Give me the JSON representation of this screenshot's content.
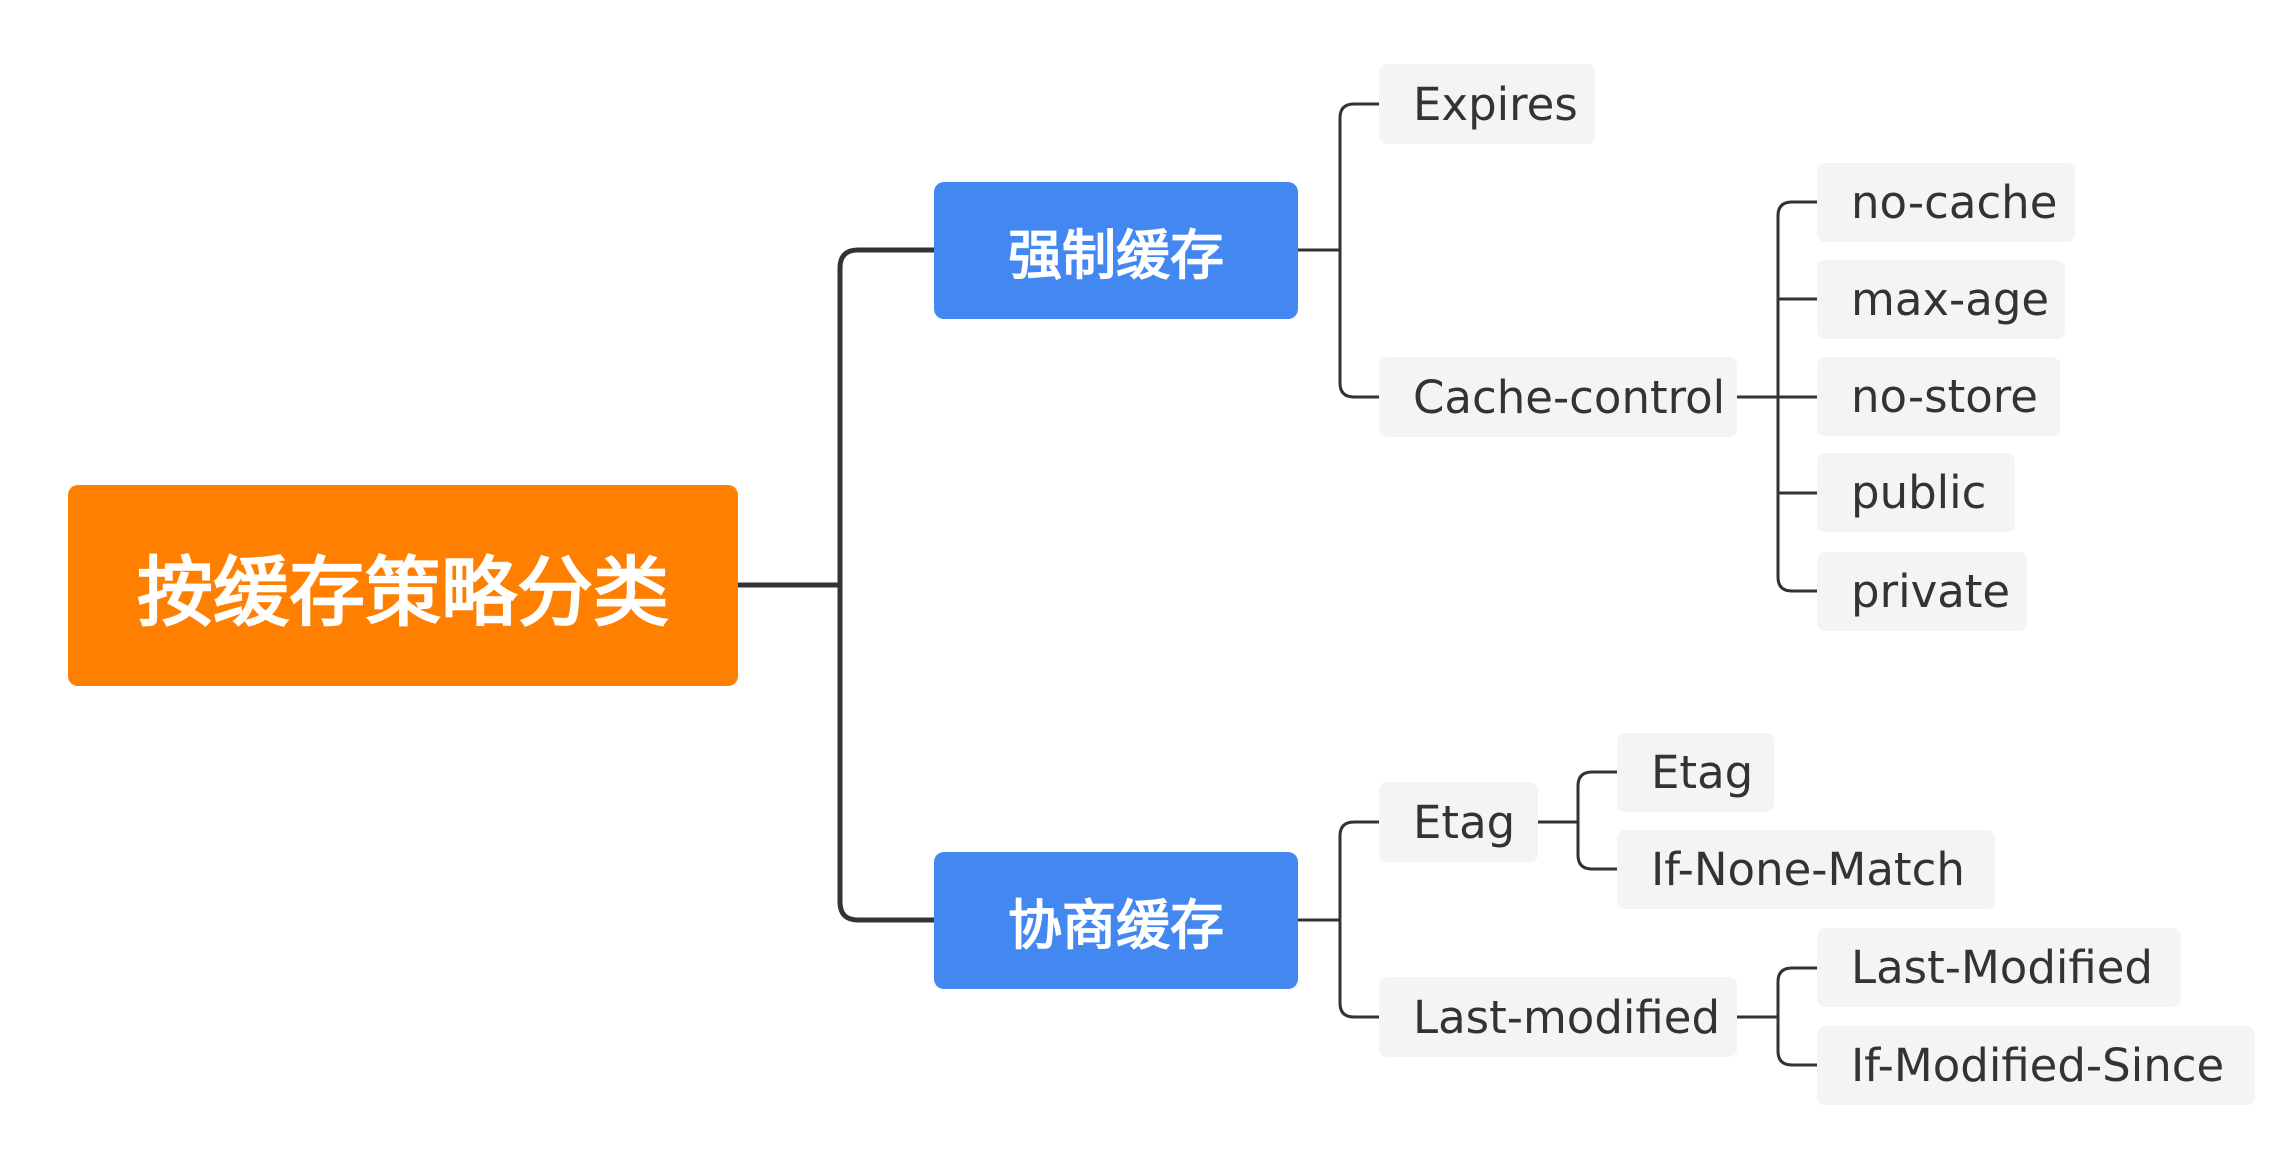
{
  "root": {
    "label": "按缓存策略分类",
    "color": "#FF7F00"
  },
  "branches": [
    {
      "label": "强制缓存",
      "color": "#4388F0",
      "children": [
        {
          "label": "Expires",
          "children": []
        },
        {
          "label": "Cache-control",
          "children": [
            "no-cache",
            "max-age",
            "no-store",
            "public",
            "private"
          ]
        }
      ]
    },
    {
      "label": "协商缓存",
      "color": "#4388F0",
      "children": [
        {
          "label": "Etag",
          "children": [
            "Etag",
            "If-None-Match"
          ]
        },
        {
          "label": "Last-modified",
          "children": [
            "Last-Modified",
            "If-Modified-Since"
          ]
        }
      ]
    }
  ]
}
